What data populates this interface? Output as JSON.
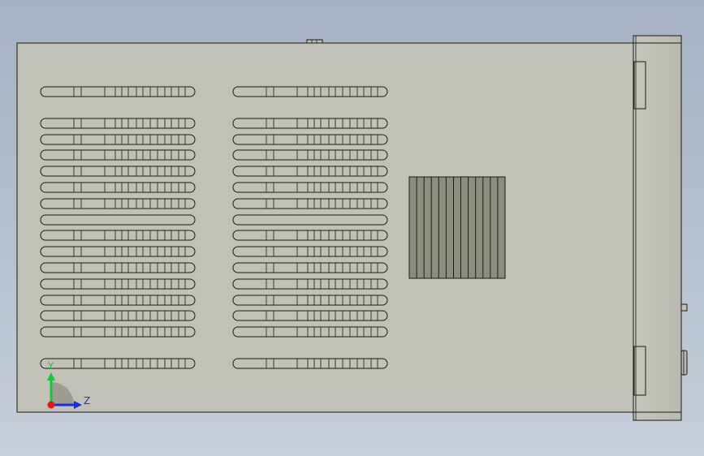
{
  "view": {
    "background_top": "#a4b2c4",
    "background_bottom": "#c7cfdb",
    "body_color": "#c1c1b8",
    "outline_color": "#1a1a1a",
    "grille_color": "#8a8e7e"
  },
  "triad": {
    "y_label": "Y",
    "z_label": "Z",
    "y_color": "#19c43a",
    "z_color": "#1530e0",
    "x_color": "#e01818"
  },
  "slot_panel": {
    "columns": 2,
    "rows": 16,
    "plain_rows": [
      7
    ]
  }
}
